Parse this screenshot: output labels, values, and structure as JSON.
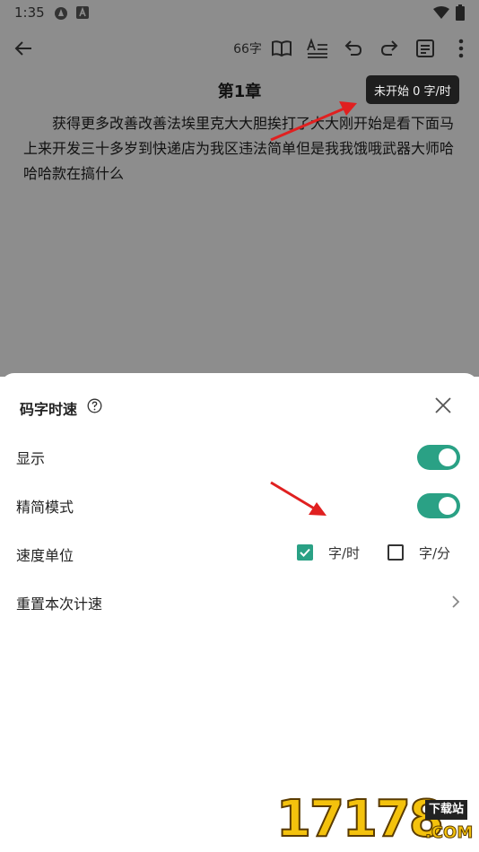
{
  "status": {
    "time": "1:35"
  },
  "toolbar": {
    "word_count": "66字"
  },
  "editor": {
    "chapter_title": "第1章",
    "tooltip": "未开始 0 字/时",
    "body": "获得更多改善改善法埃里克大大胆挨打了大大刚开始是看下面马上来开发三十多岁到快递店为我区违法简单但是我我饿哦武器大师哈哈哈款在搞什么"
  },
  "sheet": {
    "title": "码字时速",
    "rows": [
      {
        "label": "显示",
        "on": true
      },
      {
        "label": "精简模式",
        "on": true
      }
    ],
    "speed_unit": {
      "label": "速度单位",
      "options": [
        {
          "label": "字/时",
          "checked": true
        },
        {
          "label": "字/分",
          "checked": false
        }
      ]
    },
    "reset_label": "重置本次计速"
  },
  "watermark": {
    "number": "17178",
    "tag": "下载站",
    "domain": ".COM"
  },
  "colors": {
    "accent": "#2aa185",
    "annotation": "#e02020"
  }
}
